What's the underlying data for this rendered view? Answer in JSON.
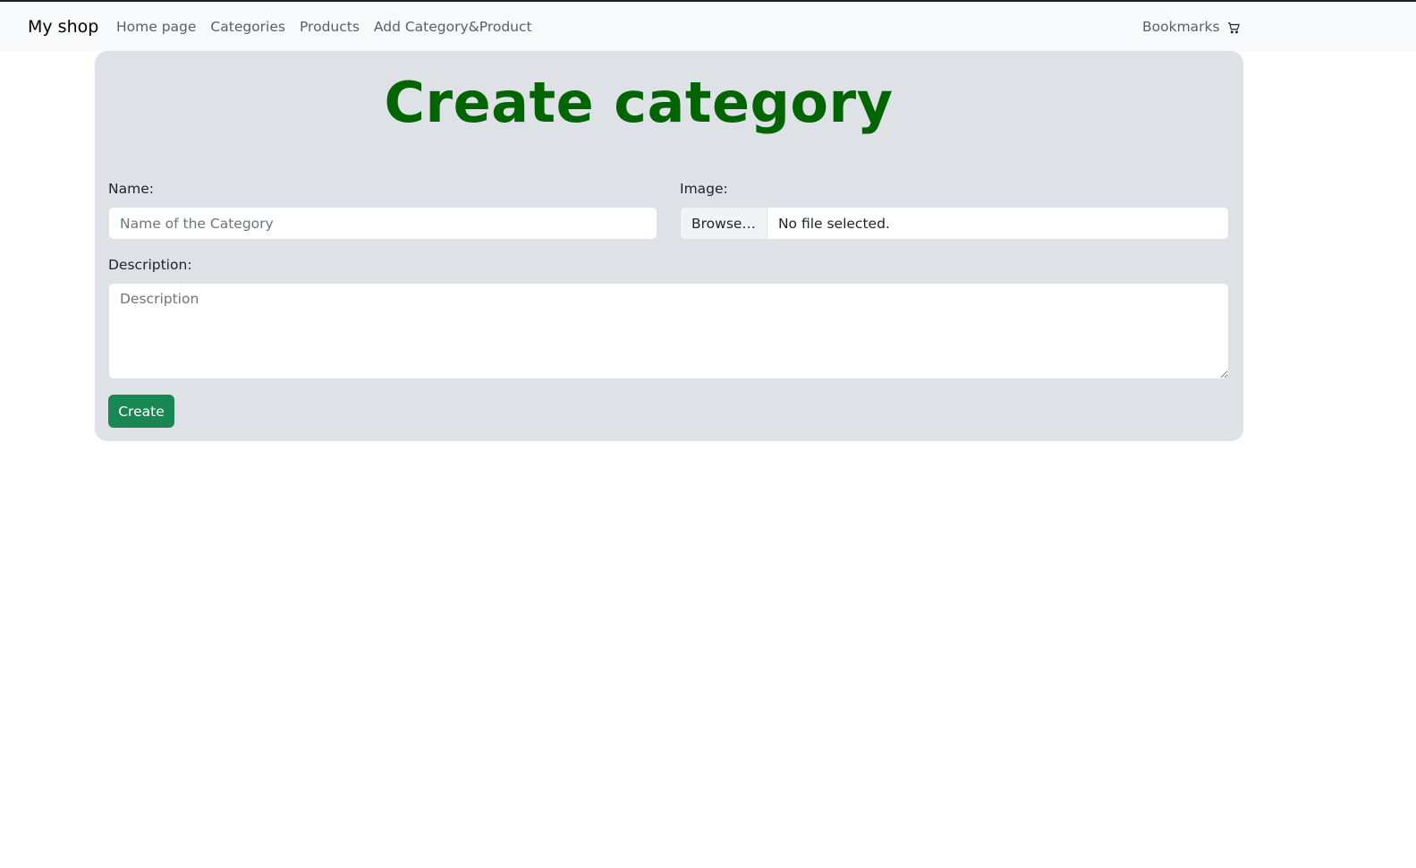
{
  "navbar": {
    "brand": "My shop",
    "links": [
      "Home page",
      "Categories",
      "Products",
      "Add Category&Product"
    ],
    "bookmarks_label": "Bookmarks",
    "cart_icon": "cart-icon"
  },
  "form": {
    "title": "Create category",
    "name_label": "Name:",
    "name_placeholder": "Name of the Category",
    "name_value": "",
    "image_label": "Image:",
    "browse_label": "Browse…",
    "file_status": "No file selected.",
    "description_label": "Description:",
    "description_placeholder": "Description",
    "description_value": "",
    "submit_label": "Create"
  },
  "colors": {
    "title": "#006400",
    "card_bg": "#dee1e6",
    "button_bg": "#198754",
    "navbar_bg": "#f8f9fa"
  }
}
